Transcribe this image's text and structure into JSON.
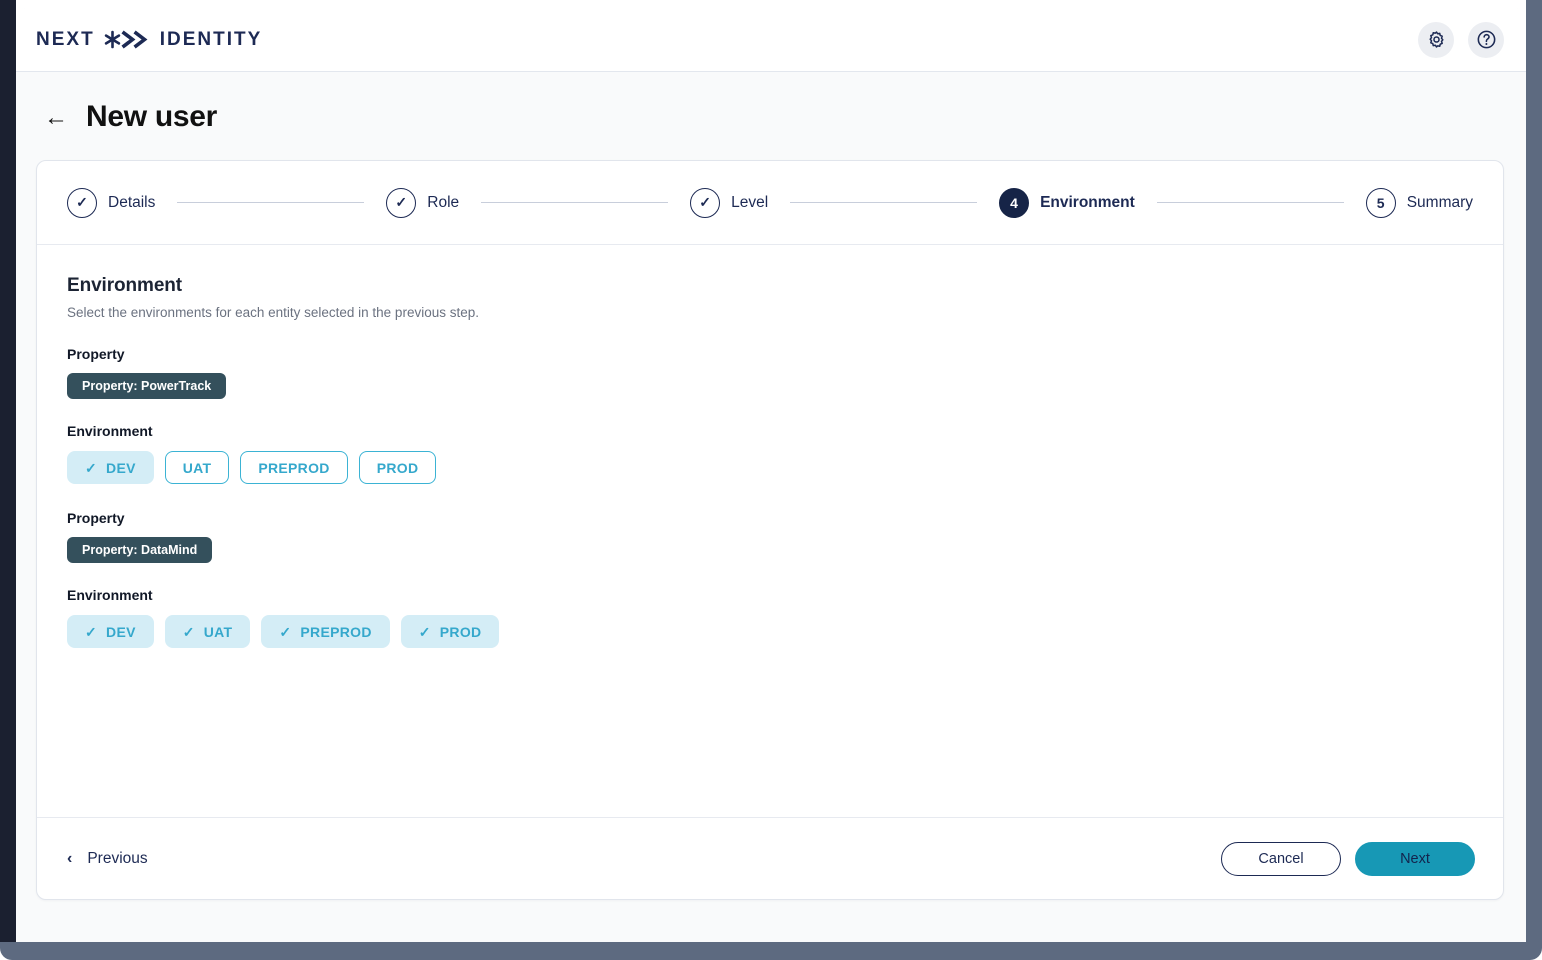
{
  "brand": {
    "word_left": "NEXT",
    "word_right": "IDENTITY",
    "star_icon": "star-asterisk-icon",
    "chevrons_icon": "double-chevron-right-icon",
    "color": "#1d2a54"
  },
  "app_bar": {
    "settings_icon": "gear-icon",
    "help_icon": "question-mark-circle-icon"
  },
  "page": {
    "back_icon": "arrow-left-icon",
    "back_glyph": "←",
    "title": "New user"
  },
  "stepper": {
    "steps": [
      {
        "number": "1",
        "label": "Details",
        "state": "complete",
        "glyph": "✓"
      },
      {
        "number": "2",
        "label": "Role",
        "state": "complete",
        "glyph": "✓"
      },
      {
        "number": "3",
        "label": "Level",
        "state": "complete",
        "glyph": "✓"
      },
      {
        "number": "4",
        "label": "Environment",
        "state": "active",
        "glyph": "4"
      },
      {
        "number": "5",
        "label": "Summary",
        "state": "upcoming",
        "glyph": "5"
      }
    ]
  },
  "content": {
    "heading": "Environment",
    "subheading": "Select the environments for each entity selected in the previous step.",
    "property_label": "Property",
    "environment_label": "Environment",
    "check_glyph": "✓",
    "entities": [
      {
        "property_label": "Property",
        "property_chip": "Property: PowerTrack",
        "environment_label": "Environment",
        "environments": [
          {
            "name": "DEV",
            "selected": true
          },
          {
            "name": "UAT",
            "selected": false
          },
          {
            "name": "PREPROD",
            "selected": false
          },
          {
            "name": "PROD",
            "selected": false
          }
        ]
      },
      {
        "property_label": "Property",
        "property_chip": "Property: DataMind",
        "environment_label": "Environment",
        "environments": [
          {
            "name": "DEV",
            "selected": true
          },
          {
            "name": "UAT",
            "selected": true
          },
          {
            "name": "PREPROD",
            "selected": true
          },
          {
            "name": "PROD",
            "selected": true
          }
        ]
      }
    ]
  },
  "footer": {
    "previous_label": "Previous",
    "previous_icon": "chevron-left-icon",
    "previous_glyph": "‹",
    "cancel_label": "Cancel",
    "next_label": "Next"
  },
  "colors": {
    "navy": "#1d2a54",
    "teal": "#1798b5",
    "cyan": "#35a8cc",
    "chip_selected_bg": "#d4edf6",
    "property_chip_bg": "#34505c"
  }
}
